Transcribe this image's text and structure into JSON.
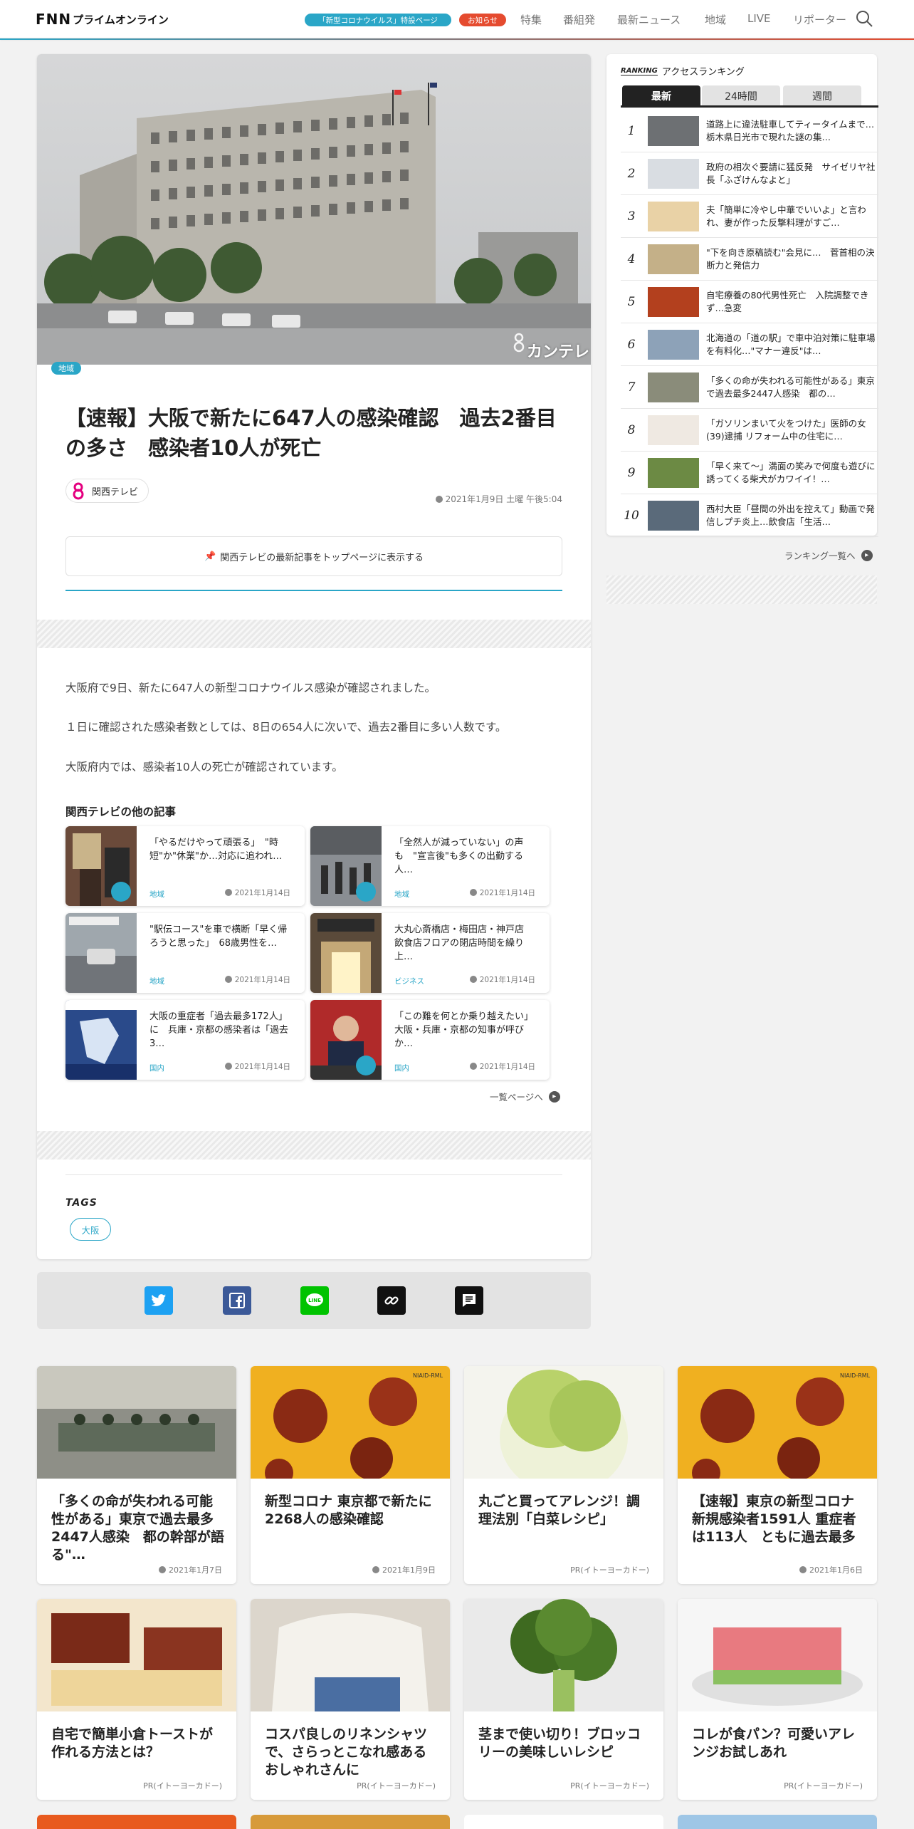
{
  "header": {
    "logo_fnn": "FNN",
    "logo_sub": "プライムオンライン",
    "corona_pill": "「新型コロナウイルス」特設ページ",
    "notice_pill": "お知らせ",
    "nav": [
      "特集",
      "番組発",
      "最新ニュース",
      "地域",
      "LIVE",
      "リポーター"
    ]
  },
  "article": {
    "category": "地域",
    "title": "【速報】大阪で新たに647人の感染確認　過去2番目の多さ　感染者10人が死亡",
    "source": "関西テレビ",
    "datetime": "2021年1月9日 土曜 午後5:04",
    "watermark": "カンテレ",
    "pin_button": "関西テレビの最新記事をトップページに表示する",
    "body": [
      "大阪府で9日、新たに647人の新型コロナウイルス感染が確認されました。",
      "１日に確認された感染者数としては、8日の654人に次いで、過去2番目に多い人数です。",
      "大阪府内では、感染者10人の死亡が確認されています。"
    ],
    "related_heading": "関西テレビの他の記事",
    "related": [
      {
        "title": "「やるだけやって頑張る」　\"時短\"か\"休業\"か…対応に追われ…",
        "category": "地域",
        "date": "2021年1月14日"
      },
      {
        "title": "「全然人が減っていない」の声も　\"宣言後\"も多くの出勤する人…",
        "category": "地域",
        "date": "2021年1月14日"
      },
      {
        "title": "\"駅伝コース\"を車で横断「早く帰ろうと思った」　68歳男性を…",
        "category": "地域",
        "date": "2021年1月14日"
      },
      {
        "title": "大丸心斎橋店・梅田店・神戸店　飲食店フロアの閉店時間を繰り上…",
        "category": "ビジネス",
        "date": "2021年1月14日"
      },
      {
        "title": "大阪の重症者「過去最多172人」に　兵庫・京都の感染者は「過去3…",
        "category": "国内",
        "date": "2021年1月14日"
      },
      {
        "title": "「この難を何とか乗り越えたい」大阪・兵庫・京都の知事が呼びか…",
        "category": "国内",
        "date": "2021年1月14日"
      }
    ],
    "more_link": "一覧ページへ",
    "tags_heading": "TAGS",
    "tags": [
      "大阪"
    ]
  },
  "ranking": {
    "label_rk": "RANKING",
    "title": "アクセスランキング",
    "tabs": [
      "最新",
      "24時間",
      "週間"
    ],
    "items": [
      {
        "n": "1",
        "title": "道路上に違法駐車してティータイムまで…栃木県日光市で現れた謎の集…"
      },
      {
        "n": "2",
        "title": "政府の相次ぐ要請に猛反発　サイゼリヤ社長「ふざけんなよと」"
      },
      {
        "n": "3",
        "title": "夫「簡単に冷やし中華でいいよ」と言われ、妻が作った反撃料理がすご…"
      },
      {
        "n": "4",
        "title": "\"下を向き原稿読む\"会見に…　菅首相の決断力と発信力"
      },
      {
        "n": "5",
        "title": "自宅療養の80代男性死亡　入院調整できず…急変"
      },
      {
        "n": "6",
        "title": "北海道の「道の駅」で車中泊対策に駐車場を有料化…\"マナー違反\"は…"
      },
      {
        "n": "7",
        "title": "「多くの命が失われる可能性がある」東京で過去最多2447人感染　都の…"
      },
      {
        "n": "8",
        "title": "「ガソリンまいて火をつけた」医師の女(39)逮捕 リフォーム中の住宅に…"
      },
      {
        "n": "9",
        "title": "「早く来て～」満面の笑みで何度も遊びに誘ってくる柴犬がカワイイ！…"
      },
      {
        "n": "10",
        "title": "西村大臣「昼間の外出を控えて」動画で発信しプチ炎上…飲食店「生活…"
      }
    ],
    "more_link": "ランキング一覧へ"
  },
  "grid": [
    {
      "title": "「多くの命が失われる可能性がある」東京で過去最多2447人感染　都の幹部が語る\"…",
      "meta": "2021年1月7日",
      "pr": false
    },
    {
      "title": "新型コロナ 東京都で新たに2268人の感染確認",
      "meta": "2021年1月9日",
      "pr": false
    },
    {
      "title": "丸ごと買ってアレンジ！調理法別「白菜レシピ」",
      "meta": "PR(イトーヨーカドー)",
      "pr": true
    },
    {
      "title": "【速報】東京の新型コロナ新規感染者1591人 重症者は113人　ともに過去最多",
      "meta": "2021年1月6日",
      "pr": false
    },
    {
      "title": "自宅で簡単小倉トーストが作れる方法とは？",
      "meta": "PR(イトーヨーカドー)",
      "pr": true
    },
    {
      "title": "コスパ良しのリネンシャツで、さらっとこなれ感あるおしゃれさんに",
      "meta": "PR(イトーヨーカドー)",
      "pr": true
    },
    {
      "title": "茎まで使い切り！ブロッコリーの美味しいレシピ",
      "meta": "PR(イトーヨーカドー)",
      "pr": true
    },
    {
      "title": "コレが食パン？可愛いアレンジお試しあれ",
      "meta": "PR(イトーヨーカドー)",
      "pr": true
    }
  ],
  "virus_credit": "NIAID-RML",
  "colors": {
    "accent": "#2aa6c7",
    "notice": "#e54b2f",
    "twitter": "#1da1f2",
    "facebook": "#3b5998",
    "line": "#00c300"
  }
}
